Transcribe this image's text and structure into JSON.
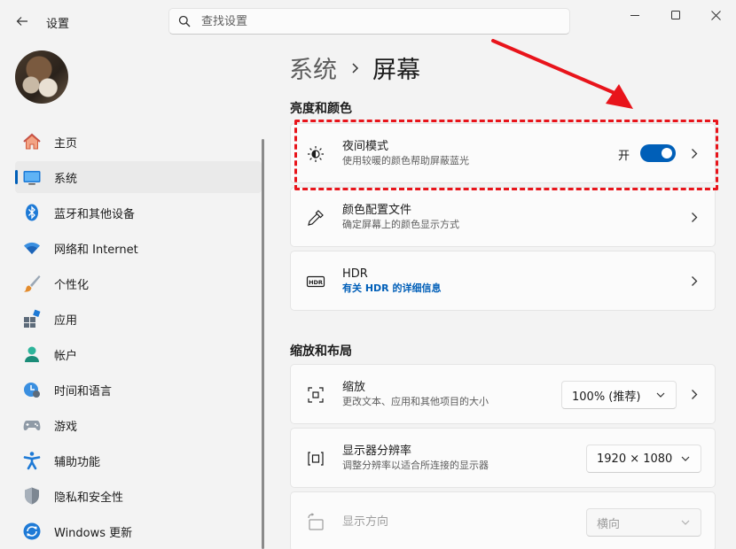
{
  "window": {
    "title": "设置",
    "controls": [
      "minimize",
      "maximize",
      "close"
    ]
  },
  "search": {
    "placeholder": "查找设置",
    "value": ""
  },
  "sidebar": {
    "items": [
      {
        "label": "主页",
        "icon": "home-icon",
        "active": false
      },
      {
        "label": "系统",
        "icon": "system-icon",
        "active": true
      },
      {
        "label": "蓝牙和其他设备",
        "icon": "bluetooth-icon",
        "active": false
      },
      {
        "label": "网络和 Internet",
        "icon": "wifi-icon",
        "active": false
      },
      {
        "label": "个性化",
        "icon": "brush-icon",
        "active": false
      },
      {
        "label": "应用",
        "icon": "apps-icon",
        "active": false
      },
      {
        "label": "帐户",
        "icon": "account-icon",
        "active": false
      },
      {
        "label": "时间和语言",
        "icon": "time-language-icon",
        "active": false
      },
      {
        "label": "游戏",
        "icon": "gamepad-icon",
        "active": false
      },
      {
        "label": "辅助功能",
        "icon": "accessibility-icon",
        "active": false
      },
      {
        "label": "隐私和安全性",
        "icon": "shield-icon",
        "active": false
      },
      {
        "label": "Windows 更新",
        "icon": "update-icon",
        "active": false
      }
    ]
  },
  "breadcrumb": {
    "parent": "系统",
    "current": "屏幕"
  },
  "sections": {
    "brightness_color": {
      "title": "亮度和颜色",
      "night_light": {
        "title": "夜间模式",
        "desc": "使用较暖的颜色帮助屏蔽蓝光",
        "toggle_label": "开",
        "toggle_on": true
      },
      "color_profile": {
        "title": "颜色配置文件",
        "desc": "确定屏幕上的颜色显示方式"
      },
      "hdr": {
        "title": "HDR",
        "link": "有关 HDR 的详细信息"
      }
    },
    "scale_layout": {
      "title": "缩放和布局",
      "scale": {
        "title": "缩放",
        "desc": "更改文本、应用和其他项目的大小",
        "value": "100% (推荐)"
      },
      "resolution": {
        "title": "显示器分辨率",
        "desc": "调整分辨率以适合所连接的显示器",
        "value": "1920 × 1080"
      },
      "orientation": {
        "title": "显示方向",
        "value": "横向",
        "disabled": true
      }
    }
  },
  "colors": {
    "accent": "#005fb8",
    "annotation": "#e8141b",
    "background": "#f3f3f3",
    "card": "#fbfbfb"
  }
}
